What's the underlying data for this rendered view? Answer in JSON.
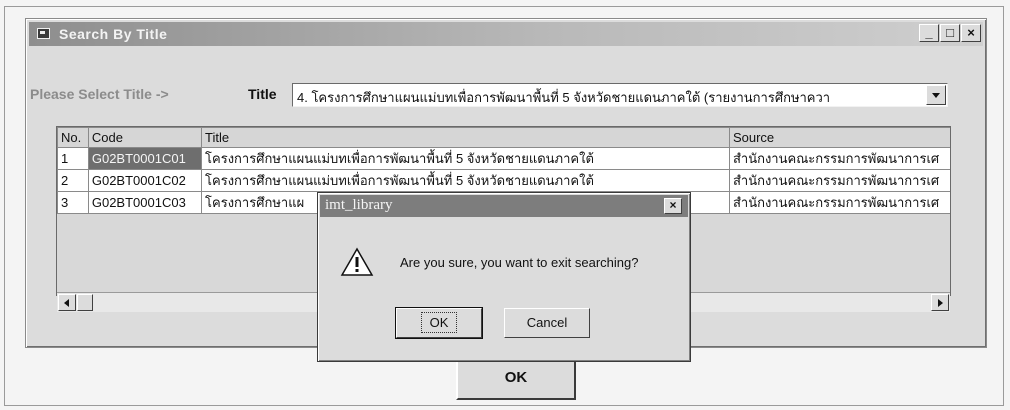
{
  "window": {
    "title": "Search By Title",
    "caption_min": "_",
    "caption_max": "□",
    "caption_close": "×"
  },
  "search": {
    "prompt": "Please Select Title ->",
    "title_label": "Title",
    "selected_title": "4. โครงการศึกษาแผนแม่บทเพื่อการพัฒนาพื้นที่ 5 จังหวัดชายแดนภาคใต้ (รายงานการศึกษาควา"
  },
  "grid": {
    "columns": [
      "No.",
      "Code",
      "Title",
      "Source"
    ],
    "rows": [
      {
        "no": "1",
        "code": "G02BT0001C01",
        "title": "โครงการศึกษาแผนแม่บทเพื่อการพัฒนาพื้นที่ 5 จังหวัดชายแดนภาคใต้",
        "source": "สำนักงานคณะกรรมการพัฒนาการเศ"
      },
      {
        "no": "2",
        "code": "G02BT0001C02",
        "title": "โครงการศึกษาแผนแม่บทเพื่อการพัฒนาพื้นที่ 5 จังหวัดชายแดนภาคใต้",
        "source": "สำนักงานคณะกรรมการพัฒนาการเศ"
      },
      {
        "no": "3",
        "code": "G02BT0001C03",
        "title": "โครงการศึกษาแผ",
        "source": "สำนักงานคณะกรรมการพัฒนาการเศ"
      }
    ]
  },
  "main_ok_label": "OK",
  "dialog": {
    "title": "imt_library",
    "close": "×",
    "message": "Are you sure, you want to exit searching?",
    "ok_label": "OK",
    "cancel_label": "Cancel",
    "icon": "warning-icon"
  }
}
